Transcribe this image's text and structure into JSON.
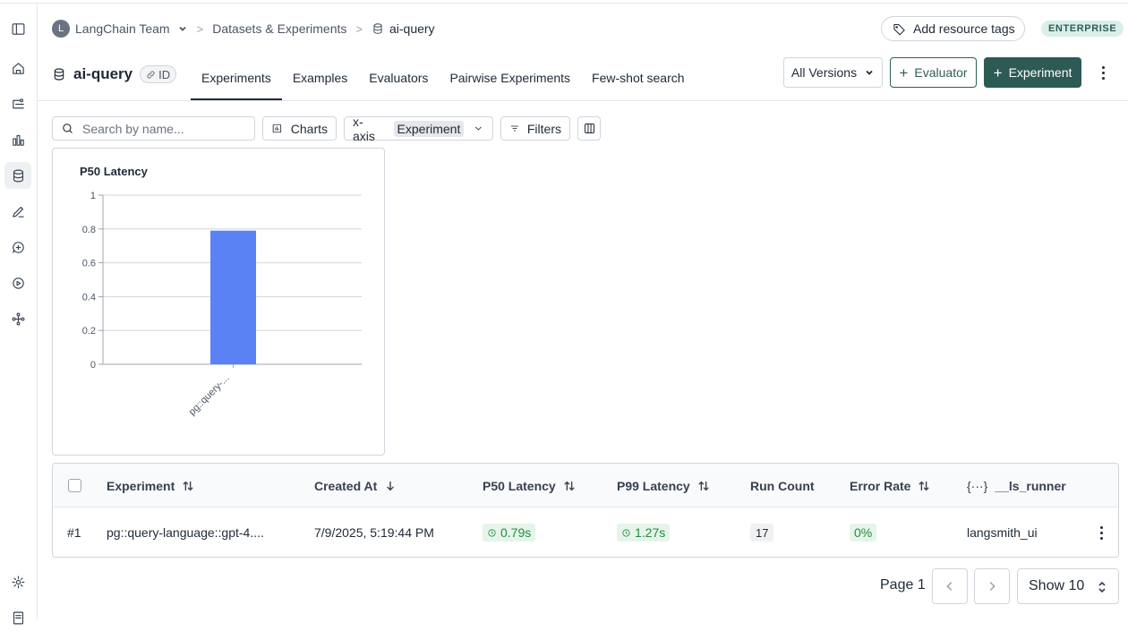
{
  "sidebar": {
    "icons": [
      "panel-toggle-icon",
      "home-icon",
      "tracing-icon",
      "monitoring-icon",
      "datasets-icon",
      "annotation-icon",
      "prompts-icon",
      "playground-icon",
      "deployments-icon",
      "settings-icon",
      "docs-icon"
    ]
  },
  "breadcrumb": {
    "avatar_letter": "L",
    "workspace": "LangChain Team",
    "section": "Datasets & Experiments",
    "current": "ai-query"
  },
  "header": {
    "add_tags_label": "Add resource tags",
    "plan_badge": "ENTERPRISE",
    "title": "ai-query",
    "id_label": "ID",
    "tabs": [
      "Experiments",
      "Examples",
      "Evaluators",
      "Pairwise Experiments",
      "Few-shot search"
    ],
    "active_tab": "Experiments",
    "versions_label": "All Versions",
    "evaluator_label": "Evaluator",
    "experiment_label": "Experiment"
  },
  "toolbar": {
    "search_placeholder": "Search by name...",
    "charts_label": "Charts",
    "xaxis_label": "x-axis",
    "xaxis_value": "Experiment",
    "filters_label": "Filters"
  },
  "chart_data": {
    "type": "bar",
    "title": "P50 Latency",
    "categories": [
      "pg::query-..."
    ],
    "values": [
      0.79
    ],
    "ylim": [
      0,
      1
    ],
    "yticks": [
      "0",
      "0.2",
      "0.4",
      "0.6",
      "0.8",
      "1"
    ],
    "grid": true,
    "bar_color": "#5b82f5"
  },
  "table": {
    "columns": [
      "Experiment",
      "Created At",
      "P50 Latency",
      "P99 Latency",
      "Run Count",
      "Error Rate",
      "__ls_runner"
    ],
    "runner_prefix": "{···}",
    "rows": [
      {
        "index": "#1",
        "experiment": "pg::query-language::gpt-4....",
        "created_at": "7/9/2025, 5:19:44 PM",
        "p50": "0.79s",
        "p99": "1.27s",
        "run_count": "17",
        "error_rate": "0%",
        "runner": "langsmith_ui"
      }
    ]
  },
  "pagination": {
    "page_label": "Page 1",
    "show_label": "Show 10"
  }
}
